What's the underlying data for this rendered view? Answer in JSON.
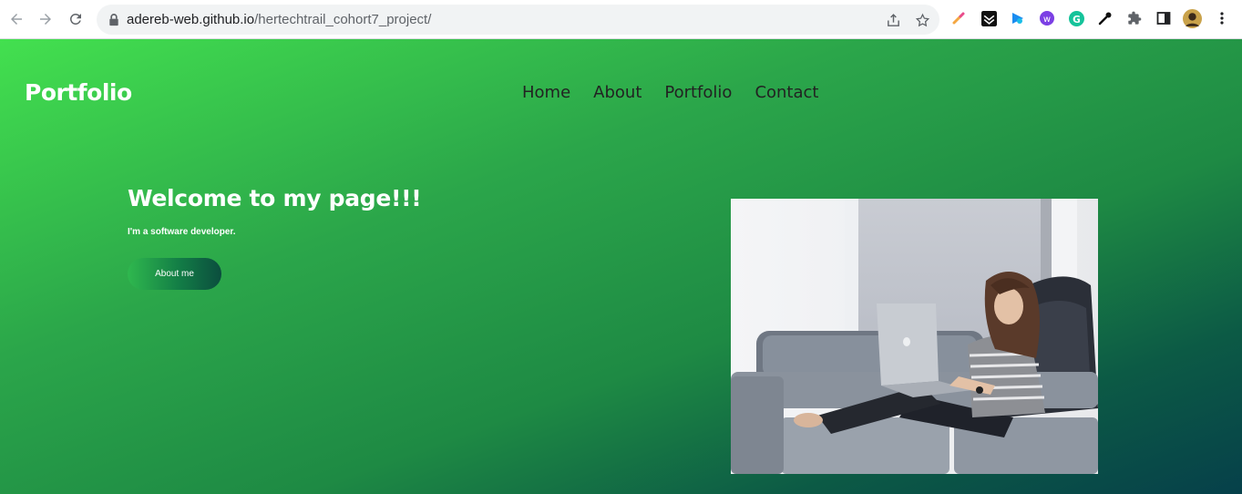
{
  "browser": {
    "url_host": "adereb-web.github.io",
    "url_path": "/hertechtrail_cohort7_project/",
    "icons": {
      "back": "arrow-left-icon",
      "forward": "arrow-right-icon",
      "reload": "reload-icon",
      "lock": "lock-icon",
      "share": "share-icon",
      "bookmark": "star-icon",
      "extensions": [
        "color-picker-extension-icon",
        "dark-reader-extension-icon",
        "play-extension-icon",
        "w-extension-icon",
        "grammarly-icon",
        "eyedropper-icon",
        "puzzle-icon",
        "side-panel-icon",
        "profile-avatar",
        "kebab-menu-icon"
      ]
    }
  },
  "site": {
    "logo": "Portfolio",
    "nav": [
      "Home",
      "About",
      "Portfolio",
      "Contact"
    ],
    "hero": {
      "title": "Welcome to my page!!!",
      "subtitle": "I'm a software developer.",
      "button_label": "About me"
    },
    "image": "woman-on-couch-with-laptop-photo"
  },
  "colors": {
    "gradient_start": "#43e04f",
    "gradient_end": "#06404a",
    "nav_text": "#222222",
    "hero_text": "#ffffff"
  }
}
